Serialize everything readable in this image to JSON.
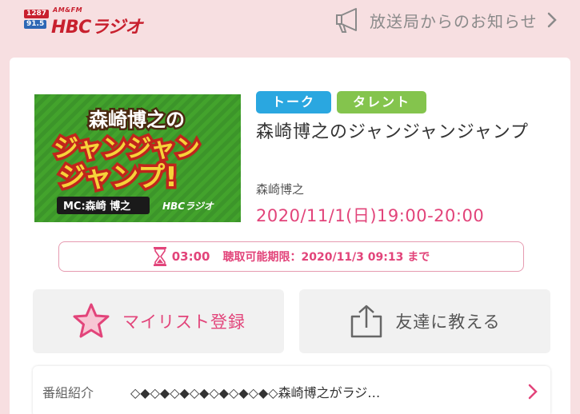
{
  "header": {
    "logo_freq_am": "1287",
    "logo_freq_fm": "91.5",
    "logo_amfm": "AM&FM",
    "logo_text": "HBCラジオ",
    "notice_label": "放送局からのお知らせ"
  },
  "program": {
    "tags": [
      "トーク",
      "タレント"
    ],
    "title": "森崎博之のジャンジャンジャンプ",
    "host": "森崎博之",
    "airtime": "2020/11/1(日)19:00-20:00",
    "thumbnail": {
      "top_text": "森崎博之の",
      "line1": "ジャンジャン",
      "line2": "ジャンプ!",
      "mc": "MC:森崎 博之",
      "brand": "HBCラジオ"
    }
  },
  "deadline": {
    "remaining": "03:00",
    "text": "聴取可能期限：2020/11/3 09:13 まで"
  },
  "actions": {
    "mylist_label": "マイリスト登録",
    "share_label": "友達に教える"
  },
  "intro": {
    "label": "番組紹介",
    "text": "◇◆◇◆◇◆◇◆◇◆◇◆◇◆◇森崎博之がラジ…"
  },
  "colors": {
    "background": "#f7dfe1",
    "accent_pink": "#e2447a",
    "tag_talk": "#2aa7e0",
    "tag_talent": "#84c44d",
    "brand_red": "#c8202e"
  },
  "icons": {
    "notice": "megaphone-icon",
    "mylist": "star-icon",
    "share": "share-icon",
    "deadline": "hourglass-icon",
    "chevron": "chevron-right-icon"
  }
}
